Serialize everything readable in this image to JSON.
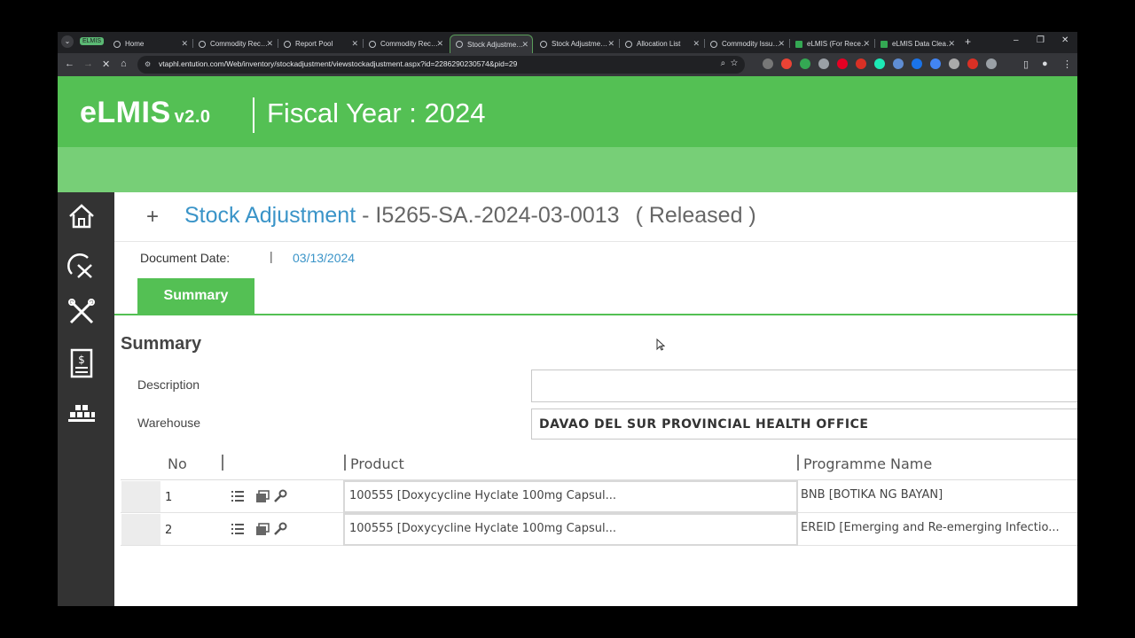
{
  "browser": {
    "group_label": "ELMIS",
    "tabs": [
      {
        "label": "Home",
        "active": false
      },
      {
        "label": "Commodity Rec…",
        "active": false
      },
      {
        "label": "Report Pool",
        "active": false
      },
      {
        "label": "Commodity Rec…",
        "active": false
      },
      {
        "label": "Stock Adjustme…",
        "active": true
      },
      {
        "label": "Stock Adjustme…",
        "active": false
      },
      {
        "label": "Allocation List",
        "active": false
      },
      {
        "label": "Commodity Issu…",
        "active": false
      },
      {
        "label": "eLMIS (For Rece…",
        "active": false
      },
      {
        "label": "eLMIS Data Clea…",
        "active": false
      }
    ],
    "url": "vtaphl.entution.com/Web/inventory/stockadjustment/viewstockadjustment.aspx?id=2286290230574&pid=29"
  },
  "header": {
    "logo": "eLMIS",
    "logo_version": "v2.0",
    "fiscal_year": "Fiscal Year : 2024"
  },
  "sidenav": {
    "items": [
      {
        "name": "home-icon"
      },
      {
        "name": "dashboard-tools-icon"
      },
      {
        "name": "tools-icon"
      },
      {
        "name": "finance-document-icon"
      },
      {
        "name": "warehouse-boxes-icon"
      }
    ]
  },
  "page": {
    "plus": "+",
    "title": "Stock Adjustment",
    "title_sep": " - ",
    "doc_code": "I5265-SA.-2024-03-0013",
    "status": "( Released )",
    "doc_date_label": "Document Date:",
    "doc_date_sep": "|",
    "doc_date": "03/13/2024",
    "tab_summary": "Summary",
    "section_title": "Summary",
    "description_label": "Description",
    "description_value": "",
    "warehouse_label": "Warehouse",
    "warehouse_value": "DAVAO DEL SUR PROVINCIAL HEALTH OFFICE"
  },
  "grid": {
    "columns": {
      "no": "No",
      "product": "Product",
      "programme": "Programme Name"
    },
    "rows": [
      {
        "no": "1",
        "product": "100555 [Doxycycline Hyclate 100mg Capsul...",
        "programme": "BNB [BOTIKA NG BAYAN]"
      },
      {
        "no": "2",
        "product": "100555 [Doxycycline Hyclate 100mg Capsul...",
        "programme": "EREID [Emerging and Re-emerging Infectio..."
      }
    ]
  },
  "colors": {
    "brand_green": "#54c054",
    "light_green": "#77cf77",
    "link_blue": "#3a94c8",
    "nav_dark": "#333333"
  }
}
